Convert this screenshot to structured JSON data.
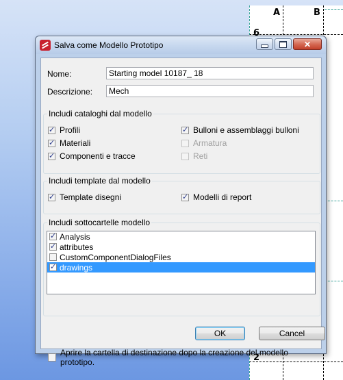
{
  "background": {
    "col_labels": [
      "A",
      "B"
    ],
    "row_labels": [
      "6",
      "2"
    ]
  },
  "dialog": {
    "title": "Salva come Modello Prototipo",
    "window_buttons": {
      "minimize": "minimize",
      "maximize": "maximize",
      "close": "✕"
    },
    "name_label": "Nome:",
    "name_value": "Starting model 10187_ 18",
    "description_label": "Descrizione:",
    "description_value": "Mech",
    "catalogs_group": {
      "title": "Includi cataloghi dal modello",
      "items": [
        {
          "label": "Profili",
          "checked": true,
          "enabled": true
        },
        {
          "label": "Materiali",
          "checked": true,
          "enabled": true
        },
        {
          "label": "Componenti e tracce",
          "checked": true,
          "enabled": true
        },
        {
          "label": "Bulloni e assemblaggi bulloni",
          "checked": true,
          "enabled": true
        },
        {
          "label": "Armatura",
          "checked": false,
          "enabled": false
        },
        {
          "label": "Reti",
          "checked": false,
          "enabled": false
        }
      ]
    },
    "templates_group": {
      "title": "Includi template dal modello",
      "items": [
        {
          "label": "Template disegni",
          "checked": true
        },
        {
          "label": "Modelli di report",
          "checked": true
        }
      ]
    },
    "subfolders_group": {
      "title": "Includi sottocartelle modello",
      "items": [
        {
          "label": "Analysis",
          "checked": true,
          "selected": false
        },
        {
          "label": "attributes",
          "checked": true,
          "selected": false
        },
        {
          "label": "CustomComponentDialogFiles",
          "checked": false,
          "selected": false
        },
        {
          "label": "drawings",
          "checked": true,
          "selected": true
        }
      ]
    },
    "ok_label": "OK",
    "cancel_label": "Cancel",
    "open_folder_label": "Aprire la cartella di destinazione dopo la creazione del modello prototipo.",
    "open_folder_checked": false
  }
}
